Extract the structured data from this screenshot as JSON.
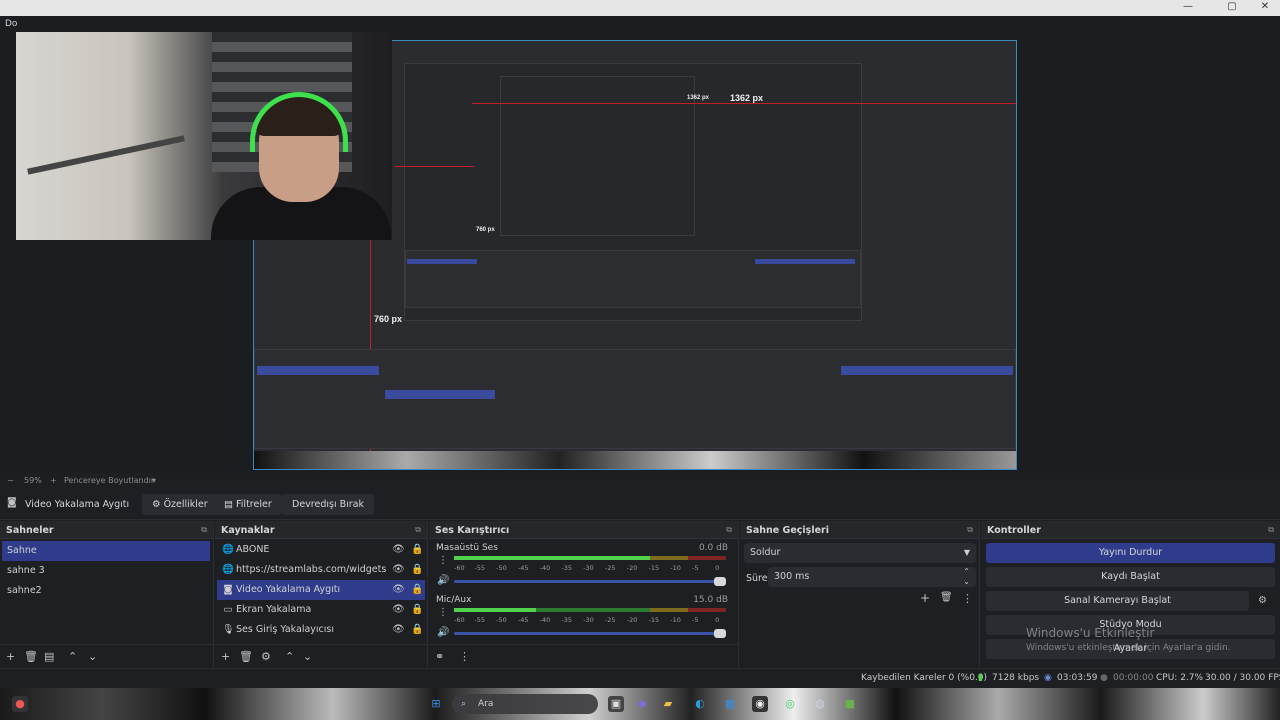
{
  "window": {
    "menu_fragment": "Do",
    "minimize": "—",
    "maximize": "▢",
    "close": "✕"
  },
  "preview": {
    "label_width": "1362 px",
    "label_height": "760 px",
    "nested_label_width": "1362 px",
    "nested_label_height": "760 px"
  },
  "zoom_bar": {
    "minus": "−",
    "zoom": "59%",
    "plus": "+",
    "fit_label": "Pencereye Boyutlandır",
    "dropdown": "▾"
  },
  "source_toolbar": {
    "source_name": "Video Yakalama Aygıtı",
    "properties": "Özellikler",
    "filters": "Filtreler",
    "deactivate": "Devredışı Bırak"
  },
  "scenes": {
    "title": "Sahneler",
    "items": [
      "Sahne",
      "sahne 3",
      "sahne2"
    ],
    "selected": 0
  },
  "sources": {
    "title": "Kaynaklar",
    "items": [
      {
        "icon": "globe",
        "label": "ABONE"
      },
      {
        "icon": "globe",
        "label": "https://streamlabs.com/widgets/chat"
      },
      {
        "icon": "camera",
        "label": "Video Yakalama Aygıtı"
      },
      {
        "icon": "monitor",
        "label": "Ekran Yakalama"
      },
      {
        "icon": "mic",
        "label": "Ses Giriş Yakalayıcısı"
      }
    ],
    "selected": 2
  },
  "mixer": {
    "title": "Ses Karıştırıcı",
    "channels": [
      {
        "name": "Masaüstü Ses",
        "db": "0.0 dB",
        "level": 0.72
      },
      {
        "name": "Mic/Aux",
        "db": "15.0 dB",
        "level": 0.3
      }
    ],
    "ticks": [
      "-60",
      "-55",
      "-50",
      "-45",
      "-40",
      "-35",
      "-30",
      "-25",
      "-20",
      "-15",
      "-10",
      "-5",
      "0"
    ]
  },
  "transitions": {
    "title": "Sahne Geçişleri",
    "type": "Soldur",
    "duration_label": "Süre",
    "duration_value": "300 ms"
  },
  "controls": {
    "title": "Kontroller",
    "stop_stream": "Yayını Durdur",
    "start_record": "Kaydı Başlat",
    "virtual_cam": "Sanal Kamerayı Başlat",
    "studio_mode": "Stüdyo Modu",
    "settings": "Ayarlar"
  },
  "watermark": {
    "line1": "Windows'u Etkinleştir",
    "line2": "Windows'u etkinleştirmek için Ayarlar'a gidin."
  },
  "status": {
    "dropped_frames": "Kaybedilen Kareler 0 (%0.0)",
    "bitrate": "7128 kbps",
    "stream_time": "03:03:59",
    "rec_time": "00:00:00",
    "cpu": "CPU: 2.7%",
    "fps": "30.00 / 30.00 FPS"
  },
  "taskbar": {
    "search_placeholder": "Ara"
  },
  "colors": {
    "accent": "#2f3c8c",
    "background": "#1e1f22",
    "red_guide": "#c0202a",
    "meter_green": "#4fd14a"
  }
}
